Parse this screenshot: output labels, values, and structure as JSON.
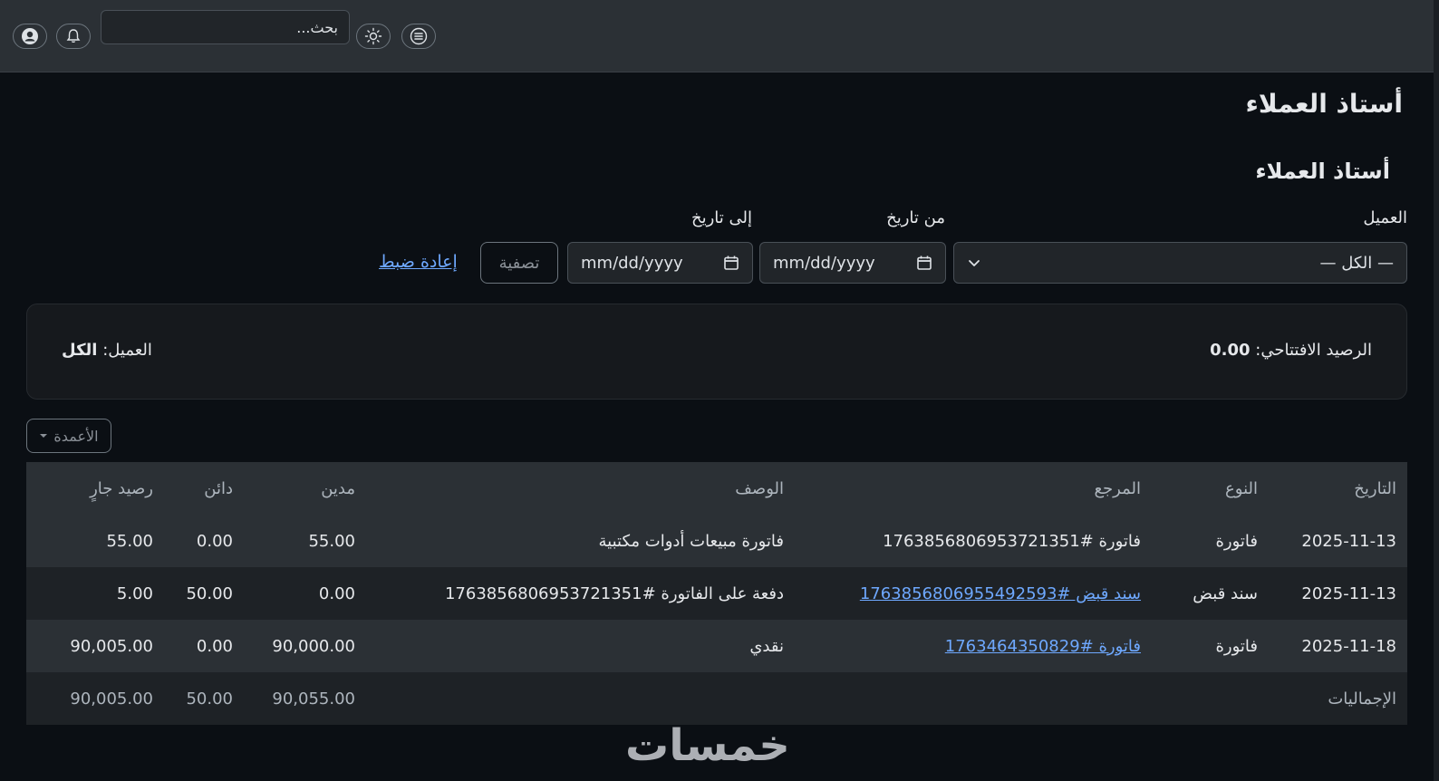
{
  "topbar": {
    "search_placeholder": "بحث...",
    "icons": [
      "user-icon",
      "bell-icon",
      "sun-icon",
      "menu-icon"
    ]
  },
  "page": {
    "title": "أستاذ العملاء",
    "subtitle": "أستاذ العملاء"
  },
  "filters": {
    "customer_label": "العميل",
    "customer_value": "— الكل —",
    "from_label": "من تاريخ",
    "from_placeholder": "mm/dd/yyyy",
    "to_label": "إلى تاريخ",
    "to_placeholder": "mm/dd/yyyy",
    "filter_button": "تصفية",
    "reset_link": "إعادة ضبط"
  },
  "summary": {
    "opening_label": "الرصيد الافتتاحي:",
    "opening_value": "0.00",
    "customer_label": "العميل:",
    "customer_value": "الكل"
  },
  "columns_button": "الأعمدة",
  "table": {
    "headers": {
      "date": "التاريخ",
      "type": "النوع",
      "ref": "المرجع",
      "desc": "الوصف",
      "debit": "مدين",
      "credit": "دائن",
      "balance": "رصيد جارٍ"
    },
    "rows": [
      {
        "date": "2025-11-13",
        "type": "فاتورة",
        "ref": "فاتورة #1763856806953721351",
        "desc": "فاتورة مبيعات أدوات مكتبية",
        "debit": "55.00",
        "credit": "0.00",
        "balance": "55.00"
      },
      {
        "date": "2025-11-13",
        "type": "سند قبض",
        "ref": "سند قبض #1763856806955492593",
        "desc": "دفعة على الفاتورة #1763856806953721351",
        "debit": "0.00",
        "credit": "50.00",
        "balance": "5.00"
      },
      {
        "date": "2025-11-18",
        "type": "فاتورة",
        "ref": "فاتورة #1763464350829",
        "desc": "نقدي",
        "debit": "90,000.00",
        "credit": "0.00",
        "balance": "90,005.00"
      }
    ],
    "totals": {
      "label": "الإجماليات",
      "debit": "90,055.00",
      "credit": "50.00",
      "balance": "90,005.00"
    }
  },
  "watermark": "خمسات"
}
